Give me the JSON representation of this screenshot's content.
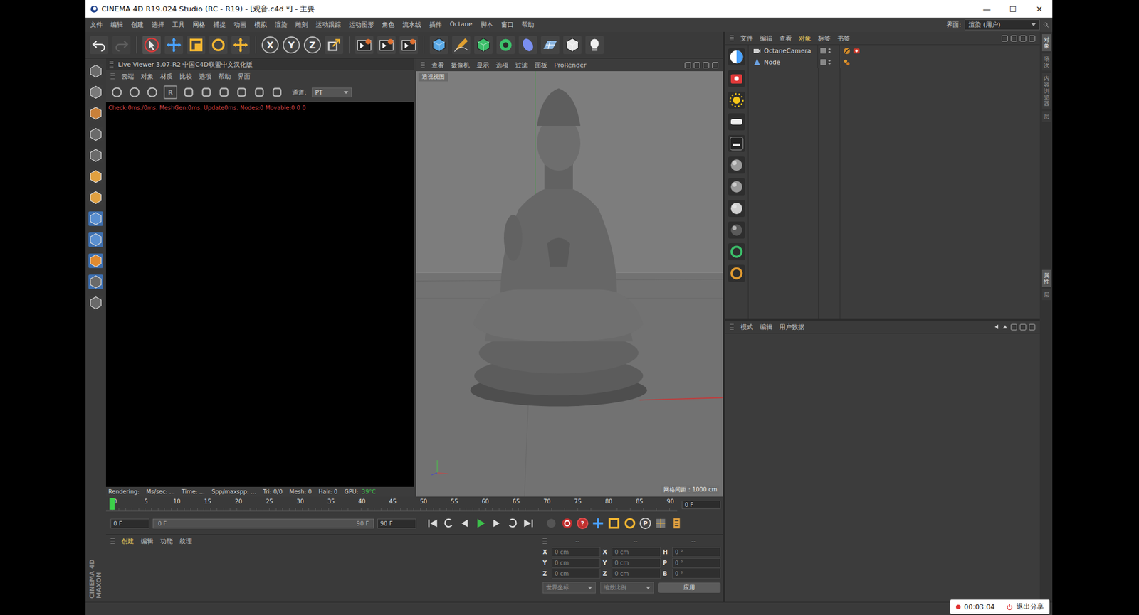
{
  "window": {
    "title": "CINEMA 4D R19.024 Studio (RC - R19) - [观音.c4d *] - 主要",
    "controls": [
      "—",
      "☐",
      "✕"
    ]
  },
  "menu": [
    "文件",
    "编辑",
    "创建",
    "选择",
    "工具",
    "网格",
    "捕捉",
    "动画",
    "模拟",
    "渲染",
    "雕刻",
    "运动跟踪",
    "运动图形",
    "角色",
    "流水线",
    "插件",
    "Octane",
    "脚本",
    "窗口",
    "帮助"
  ],
  "layout": {
    "label": "界面:",
    "value": "渲染 (用户)"
  },
  "toolbar": {
    "axes": [
      "X",
      "Y",
      "Z"
    ]
  },
  "live_viewer": {
    "title": "Live Viewer 3.07-R2 中国C4D联盟中文汉化版",
    "menu": [
      "云端",
      "对象",
      "材质",
      "比较",
      "选项",
      "帮助",
      "界面"
    ],
    "reset_button": "R",
    "channel_label": "通道:",
    "channel_value": "PT",
    "log": "Check:0ms./0ms. MeshGen:0ms. Update0ms. Nodes:0 Movable:0  0 0",
    "status": [
      "Rendering:",
      "Ms/sec: ...",
      "Time: ...",
      "Spp/maxspp: ...",
      "Tri: 0/0",
      "Mesh: 0",
      "Hair: 0",
      "GPU:"
    ],
    "gpu_temp": "39°C"
  },
  "viewport": {
    "menu": [
      "查看",
      "摄像机",
      "显示",
      "选项",
      "过滤",
      "面板",
      "ProRender"
    ],
    "view_name": "透视视图",
    "grid_spacing": "网格间距 : 1000 cm"
  },
  "timeline": {
    "ticks": [
      "0",
      "5",
      "10",
      "15",
      "20",
      "25",
      "30",
      "35",
      "40",
      "45",
      "50",
      "55",
      "60",
      "65",
      "70",
      "75",
      "80",
      "85",
      "90"
    ],
    "current_frame": "0 F",
    "start": "0 F",
    "range_start": "0 F",
    "range_end": "90 F",
    "end": "90 F",
    "playhead_level": 0,
    "help_button": "?",
    "param_button": "P"
  },
  "material_manager": {
    "menu": [
      "创建",
      "编辑",
      "功能",
      "纹理"
    ]
  },
  "coordinates": {
    "headers": [
      "--",
      "--",
      "--"
    ],
    "rows": [
      {
        "axis": "X",
        "pos": "0 cm",
        "size_axis": "X",
        "size": "0 cm",
        "rot_axis": "H",
        "rot": "0 °"
      },
      {
        "axis": "Y",
        "pos": "0 cm",
        "size_axis": "Y",
        "size": "0 cm",
        "rot_axis": "P",
        "rot": "0 °"
      },
      {
        "axis": "Z",
        "pos": "0 cm",
        "size_axis": "Z",
        "size": "0 cm",
        "rot_axis": "B",
        "rot": "0 °"
      }
    ],
    "mode1": "世界坐标",
    "mode2": "缩放比例",
    "apply": "应用"
  },
  "object_manager": {
    "menu": [
      "文件",
      "编辑",
      "查看",
      "对象",
      "标签",
      "书签"
    ],
    "objects": [
      {
        "name": "OctaneCamera",
        "selected": false
      },
      {
        "name": "Node",
        "selected": false
      }
    ]
  },
  "attributes": {
    "menu": [
      "模式",
      "编辑",
      "用户数据"
    ]
  },
  "side_tabs": {
    "top": [
      "对象",
      "场次",
      "内容浏览器",
      "层"
    ],
    "bottom": [
      "属性",
      "层"
    ]
  },
  "logo": [
    "MAXON",
    "CINEMA 4D"
  ],
  "recording": {
    "time": "00:03:04",
    "exit": "退出分享"
  }
}
